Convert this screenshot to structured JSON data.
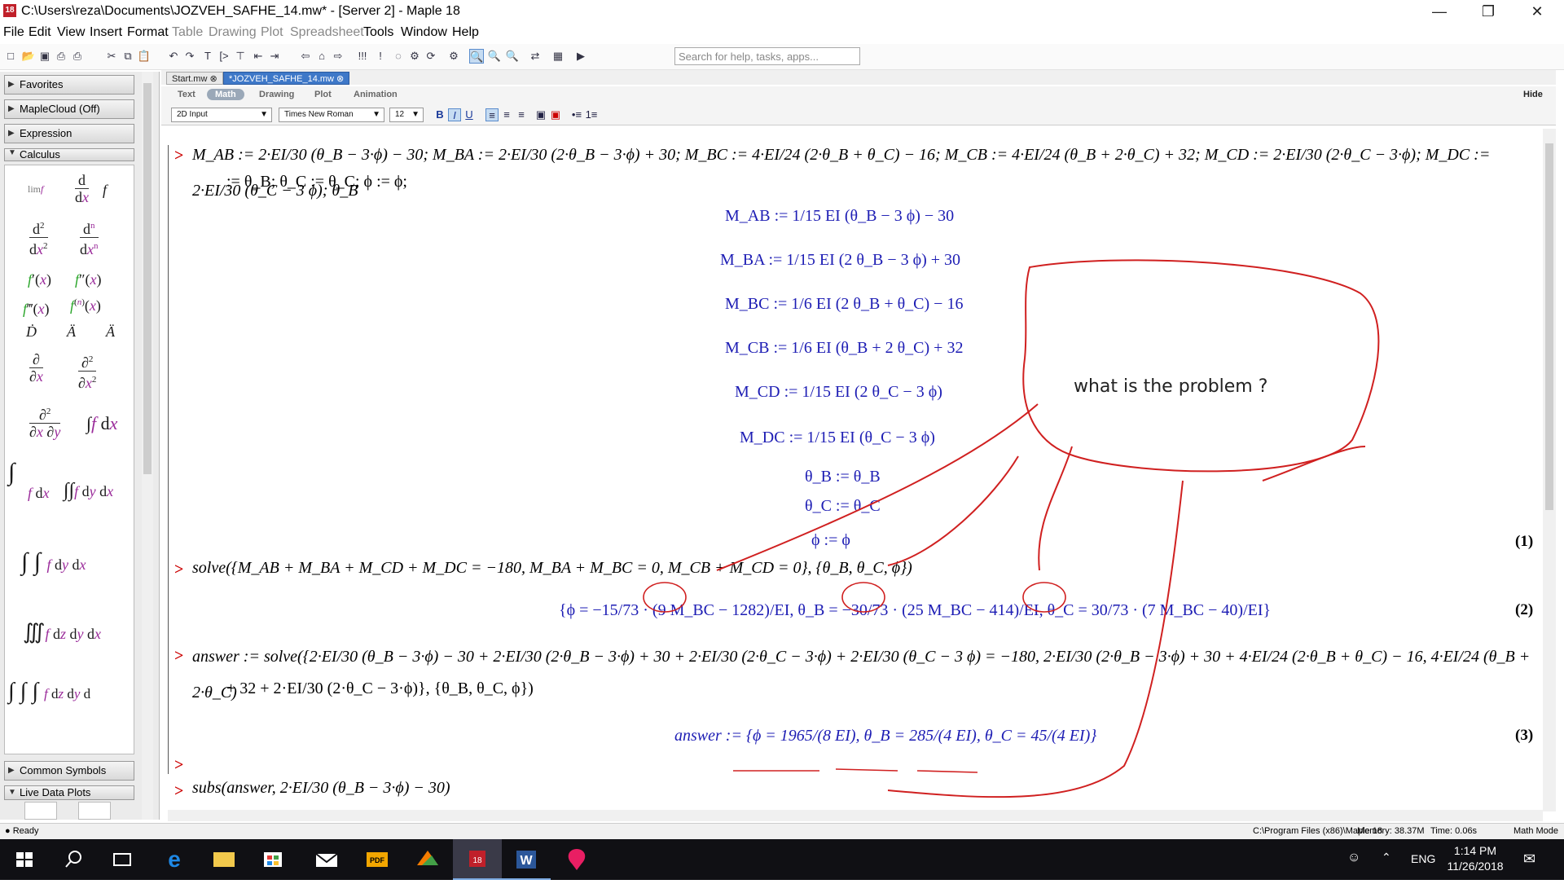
{
  "window": {
    "title": "C:\\Users\\reza\\Documents\\JOZVEH_SAFHE_14.mw* - [Server 2] - Maple 18",
    "app_icon": "maple-leaf-icon",
    "controls": [
      "minimize-icon",
      "restore-icon",
      "close-icon"
    ]
  },
  "menu": [
    {
      "label": "File"
    },
    {
      "label": "Edit"
    },
    {
      "label": "View"
    },
    {
      "label": "Insert"
    },
    {
      "label": "Format"
    },
    {
      "label": "Table",
      "disabled": true
    },
    {
      "label": "Drawing",
      "disabled": true
    },
    {
      "label": "Plot",
      "disabled": true
    },
    {
      "label": "Spreadsheet",
      "disabled": true
    },
    {
      "label": "Tools"
    },
    {
      "label": "Window"
    },
    {
      "label": "Help"
    }
  ],
  "search": {
    "placeholder": "Search for help, tasks, apps..."
  },
  "palettes": {
    "favorites": "Favorites",
    "maplecloud": "MapleCloud (Off)",
    "expression": "Expression",
    "calculus": "Calculus",
    "common_symbols": "Common Symbols",
    "live_data_plots": "Live Data Plots"
  },
  "tabs": [
    {
      "label": "Start.mw"
    },
    {
      "label": "*JOZVEH_SAFHE_14.mw",
      "active": true
    }
  ],
  "modes": {
    "text": "Text",
    "math": "Math",
    "drawing": "Drawing",
    "plot": "Plot",
    "animation": "Animation",
    "hide": "Hide"
  },
  "format": {
    "input": "2D Input",
    "font": "Times New Roman",
    "size": "12",
    "bold": "B",
    "italic": "I",
    "underline": "U"
  },
  "doc": {
    "line1": "M_AB := 2·EI/30 (θ_B − 3·ϕ) − 30; M_BA := 2·EI/30 (2·θ_B − 3·ϕ) + 30; M_BC := 4·EI/24 (2·θ_B + θ_C) − 16; M_CB := 4·EI/24 (θ_B + 2·θ_C) + 32; M_CD := 2·EI/30 (2·θ_C − 3·ϕ); M_DC := 2·EI/30 (θ_C − 3 ϕ); θ_B",
    "line1b": ":= θ_B; θ_C := θ_C; ϕ := ϕ;",
    "outputs": [
      "M_AB := 1/15 EI (θ_B − 3 ϕ) − 30",
      "M_BA := 1/15 EI (2 θ_B − 3 ϕ) + 30",
      "M_BC := 1/6 EI (2 θ_B + θ_C) − 16",
      "M_CB := 1/6 EI (θ_B + 2 θ_C) + 32",
      "M_CD := 1/15 EI (2 θ_C − 3 ϕ)",
      "M_DC := 1/15 EI (θ_C − 3 ϕ)",
      "θ_B := θ_B",
      "θ_C := θ_C",
      "ϕ := ϕ"
    ],
    "eq1": "(1)",
    "solve_in": "solve({M_AB + M_BA + M_CD + M_DC = −180, M_BA + M_BC = 0, M_CB + M_CD = 0}, {θ_B, θ_C, ϕ})",
    "solve_out": "{ϕ = −15/73 · (9 M_BC − 1282)/EI, θ_B = −30/73 · (25 M_BC − 414)/EI, θ_C = 30/73 · (7 M_BC − 40)/EI}",
    "eq2": "(2)",
    "answer_in": "answer := solve({2·EI/30 (θ_B − 3·ϕ) − 30 + 2·EI/30 (2·θ_B − 3·ϕ) + 30 + 2·EI/30 (2·θ_C − 3·ϕ) + 2·EI/30 (θ_C − 3 ϕ) = −180, 2·EI/30 (2·θ_B − 3·ϕ) + 30 + 4·EI/24 (2·θ_B + θ_C) − 16, 4·EI/24 (θ_B + 2·θ_C)",
    "answer_in2": "+ 32 + 2·EI/30 (2·θ_C − 3·ϕ)}, {θ_B, θ_C, ϕ})",
    "answer_out": "answer := {ϕ = 1965/(8 EI), θ_B = 285/(4 EI), θ_C = 45/(4 EI)}",
    "eq3": "(3)",
    "subs_in": "subs(answer, 2·EI/30 (θ_B − 3·ϕ) − 30)",
    "annotation": "what is the problem ?"
  },
  "status": {
    "ready": "Ready",
    "path": "C:\\Program Files (x86)\\Maple 18",
    "memory": "Memory: 38.37M",
    "time": "Time: 0.06s",
    "mode": "Math Mode"
  },
  "taskbar": {
    "lang": "ENG",
    "time": "1:14 PM",
    "date": "11/26/2018",
    "apps": [
      "start-icon",
      "search-icon",
      "task-view-icon",
      "edge-icon",
      "file-explorer-icon",
      "store-icon",
      "mail-icon",
      "pdf-icon",
      "wps-icon",
      "maple-icon",
      "word-icon",
      "paint-icon"
    ]
  }
}
